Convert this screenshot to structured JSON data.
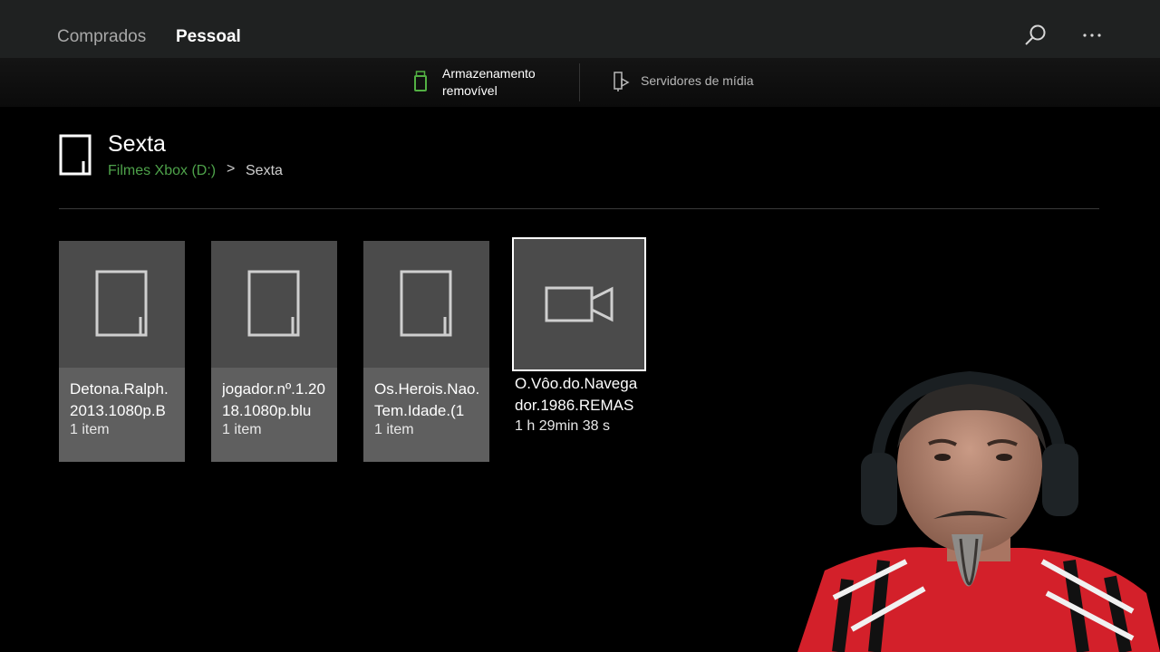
{
  "nav": {
    "tabs": [
      {
        "label": "Comprados",
        "active": false
      },
      {
        "label": "Pessoal",
        "active": true
      }
    ],
    "icons": [
      "search-icon",
      "more-icon"
    ]
  },
  "sources": [
    {
      "label": "Armazenamento removível",
      "icon": "usb-drive-icon",
      "active": true
    },
    {
      "label": "Servidores de mídia",
      "icon": "media-server-icon",
      "active": false
    }
  ],
  "header": {
    "title": "Sexta",
    "breadcrumb": {
      "parent": "Filmes Xbox (D:)",
      "separator": ">",
      "current": "Sexta"
    }
  },
  "items": [
    {
      "name": "Detona.Ralph.2013.1080p.B",
      "meta": "1 item",
      "type": "folder"
    },
    {
      "name": "jogador.nº.1.2018.1080p.blu",
      "meta": "1 item",
      "type": "folder"
    },
    {
      "name": "Os.Herois.Nao.Tem.Idade.(1",
      "meta": "1 item",
      "type": "folder"
    },
    {
      "name": "O.Vôo.do.Navegador.1986.REMAS",
      "meta": "1 h 29min 38 s",
      "type": "video",
      "selected": true
    }
  ],
  "colors": {
    "accent": "#4ea24a",
    "topbar": "#1f2121",
    "tile": "#5f5f5f",
    "tile_art": "#4b4b4b",
    "background": "#000000"
  }
}
